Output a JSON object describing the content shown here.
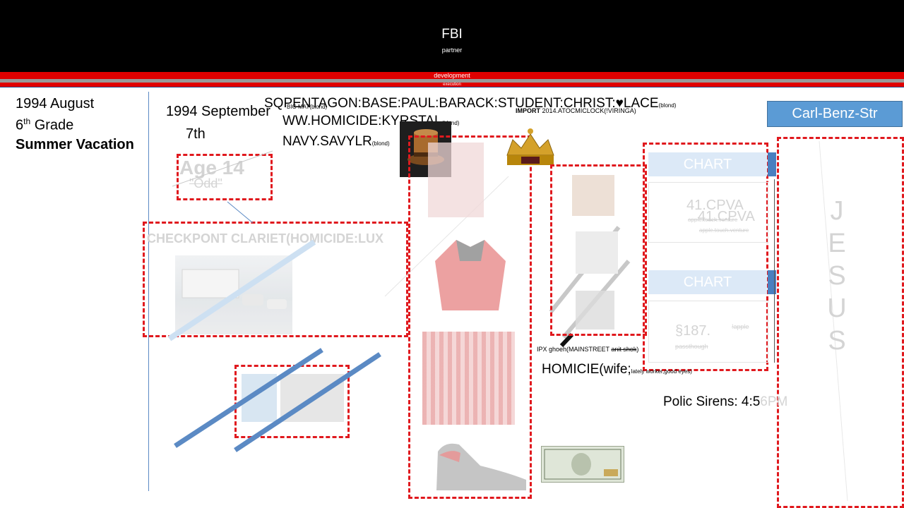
{
  "header": {
    "title": "FBI",
    "subtitle": "partner",
    "band_label": "development",
    "band_label2": "execution"
  },
  "left": {
    "date": "1994 August",
    "grade_number": "6",
    "grade_suffix": "th",
    "grade_word": "Grade",
    "summer": "Summer Vacation"
  },
  "middle": {
    "date_line1": "1994 September",
    "date_line2": "7th",
    "age": "Age 14",
    "odd": "\"Odd\"",
    "checkpoint": "CHECKPONT CLARIET(HOMICIDE:LUX"
  },
  "codes": {
    "so_prefix": "SQ",
    "line1": "PENTAGON:BASE:PAUL:BARACK:STUDENT:CHRIST:",
    "line1_heart": "♥",
    "line1_end": "LACE",
    "line1_sub": "(blond)",
    "big_mat": "BIG MAT(blond)",
    "line2": "WW.HOMICIDE:KYRSTAL",
    "line2_sub": "(blond)",
    "line3": "NAVY.SAVYLR",
    "line3_sub": "(blond)",
    "import_label": "IMPORT",
    "import_value": "2014.ATOCMICLOCK(!VIRINGA)"
  },
  "right_panel": {
    "street_button": "Carl-Benz-Str",
    "chart1": "CHART",
    "cpva1": "41.CPVA",
    "cpva2": "41.CPVA",
    "apple1": "apple.touch.venture",
    "apple2": "apple.touch.venture",
    "chart2": "CHART",
    "section": "§187.",
    "apple3": "!apple",
    "passthrough": "passthough",
    "jesus_letters": [
      "J",
      "E",
      "S",
      "U",
      "S"
    ]
  },
  "notes": {
    "ipx": "IPX ghoeh(MAINSTREET",
    "ipx_strike": "anit shok",
    "ipx_end": ")",
    "homicie": "HOMICIE(wife;",
    "homicie_sub": "lately worker,good eyes)",
    "sirens_prefix": "Polic Sirens: 4:5",
    "sirens_suffix": "6PM"
  },
  "colors": {
    "dashed_red": "#e0191e",
    "header_black": "#000000",
    "band_red": "#e00000",
    "street_blue": "#5b9bd5",
    "line_blue": "#5b8ac4"
  }
}
